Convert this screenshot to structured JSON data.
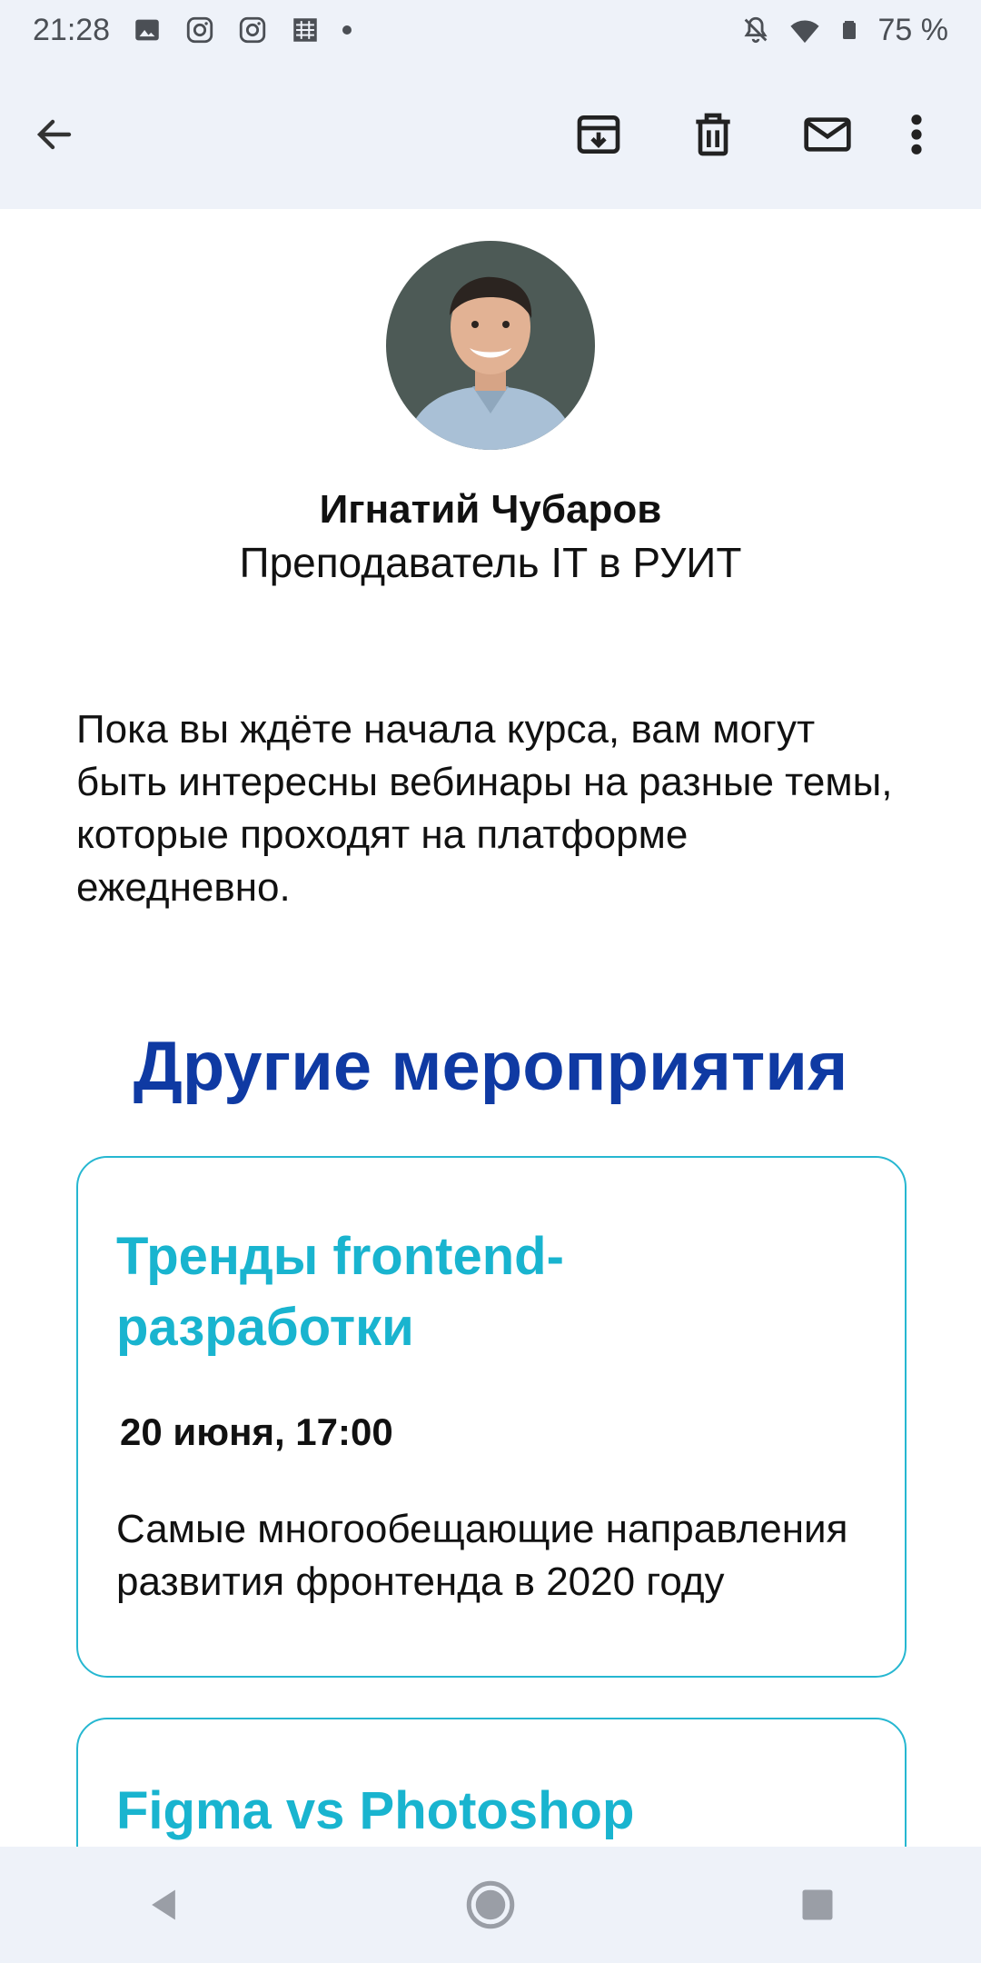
{
  "status": {
    "time": "21:28",
    "battery": "75 %",
    "left_icons": [
      "image-icon",
      "instagram-icon",
      "instagram-icon",
      "app-icon",
      "dot-icon"
    ],
    "right_icons": [
      "bell-off-icon",
      "wifi-icon",
      "battery-icon"
    ]
  },
  "toolbar": {
    "back_icon": "arrow-left-icon",
    "actions": [
      "archive-icon",
      "delete-icon",
      "mail-icon",
      "more-vert-icon"
    ]
  },
  "sender": {
    "name": "Игнатий Чубаров",
    "role": "Преподаватель IT в РУИТ"
  },
  "intro_text": "Пока вы ждёте начала курса, вам могут быть интересны вебинары на разные темы, которые проходят на платформе ежедневно.",
  "section_title": "Другие мероприятия",
  "events": [
    {
      "title": "Тренды frontend-разработки",
      "date": "20 июня, 17:00",
      "description": "Самые многообещающие направления развития фронтенда в 2020 году"
    },
    {
      "title": "Figma vs Photoshop"
    }
  ],
  "navigation": [
    "back-triangle-icon",
    "home-circle-icon",
    "recents-square-icon"
  ],
  "colors": {
    "bar_bg": "#eef2f9",
    "section_title": "#0f3aa3",
    "accent": "#19b4cf"
  }
}
